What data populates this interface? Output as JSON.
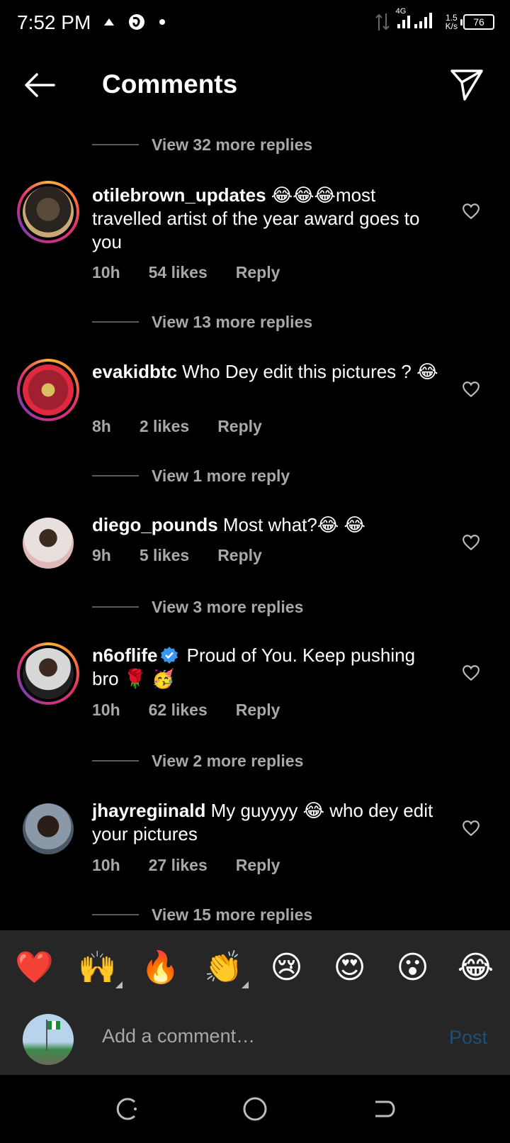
{
  "status_bar": {
    "time": "7:52 PM",
    "net_speed": "1.5",
    "net_unit": "K/s",
    "network": "4G",
    "battery": "76"
  },
  "header": {
    "title": "Comments"
  },
  "view_more": [
    {
      "label": "View 32 more replies"
    },
    {
      "label": "View 13 more replies"
    },
    {
      "label": "View 1 more reply"
    },
    {
      "label": "View 3 more replies"
    },
    {
      "label": "View 2 more replies"
    },
    {
      "label": "View 15 more replies"
    }
  ],
  "comments": [
    {
      "username": "otilebrown_updates",
      "text": " 😂😂😂most travelled artist of the year award goes to you",
      "time": "10h",
      "likes": "54 likes",
      "reply": "Reply"
    },
    {
      "username": "evakidbtc",
      "text": " Who Dey edit this pictures ? 😂",
      "time": "8h",
      "likes": "2 likes",
      "reply": "Reply"
    },
    {
      "username": "diego_pounds",
      "text": " Most what?😂 😂",
      "time": "9h",
      "likes": "5 likes",
      "reply": "Reply"
    },
    {
      "username": "n6oflife",
      "text": " Proud of You. Keep pushing bro 🌹 🥳",
      "time": "10h",
      "likes": "62 likes",
      "reply": "Reply"
    },
    {
      "username": "jhayregiinald",
      "text": " My guyyyy 😂 who dey edit your pictures",
      "time": "10h",
      "likes": "27 likes",
      "reply": "Reply"
    }
  ],
  "reactions": [
    "❤️",
    "🙌",
    "🔥",
    "👏",
    "😢",
    "😍",
    "😮",
    "😂"
  ],
  "composer": {
    "placeholder": "Add a comment…",
    "post_label": "Post"
  },
  "colors": {
    "background": "#000000",
    "secondary_text": "#a8a8a8",
    "post_disabled": "#1d4f7a",
    "verified": "#3897f0"
  }
}
